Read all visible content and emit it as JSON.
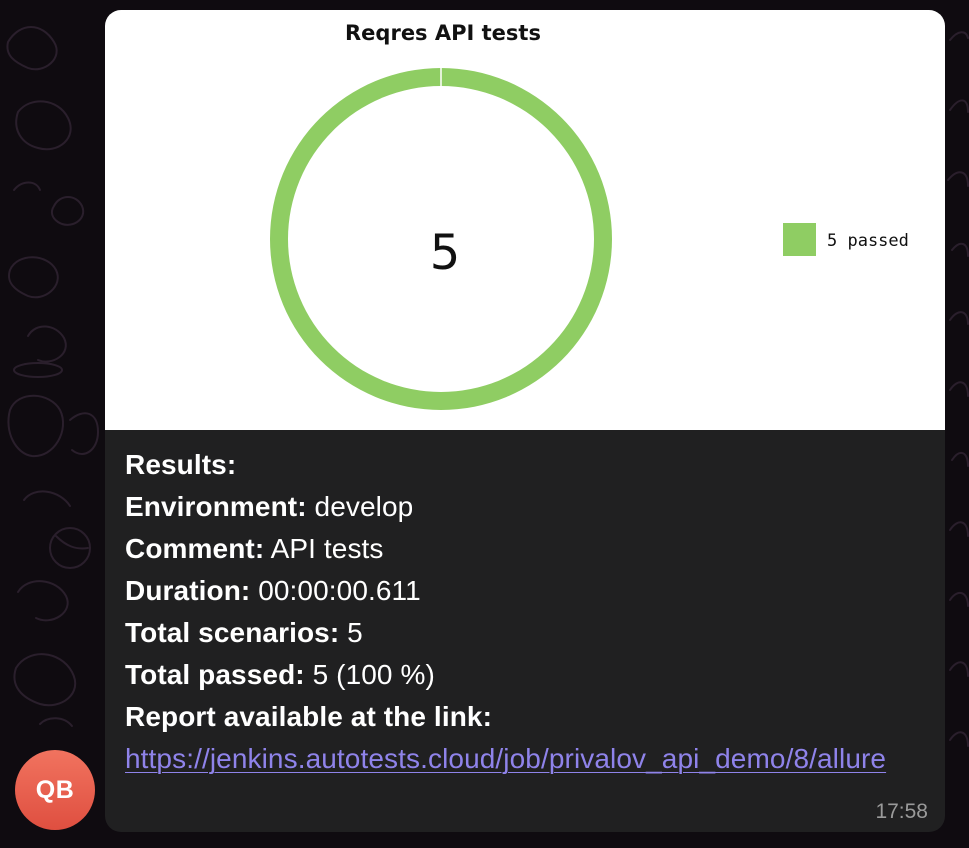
{
  "chat": {
    "avatar_initials": "QB",
    "timestamp": "17:58"
  },
  "chart_data": {
    "type": "pie",
    "title": "Reqres API tests",
    "center_label": "5",
    "slices": [
      {
        "label": "5 passed",
        "value": 5,
        "color": "#8fcd63"
      }
    ],
    "legend": "right"
  },
  "message": {
    "results_label": "Results:",
    "environment_label": "Environment:",
    "environment_value": " develop",
    "comment_label": "Comment:",
    "comment_value": " API tests",
    "duration_label": "Duration:",
    "duration_value": " 00:00:00.611",
    "total_scenarios_label": "Total scenarios:",
    "total_scenarios_value": " 5",
    "total_passed_label": "Total passed:",
    "total_passed_value": " 5 (100 %)",
    "report_label": "Report available at the link:",
    "report_url": "https://jenkins.autotests.cloud/job/privalov_api_demo/8/allure"
  }
}
